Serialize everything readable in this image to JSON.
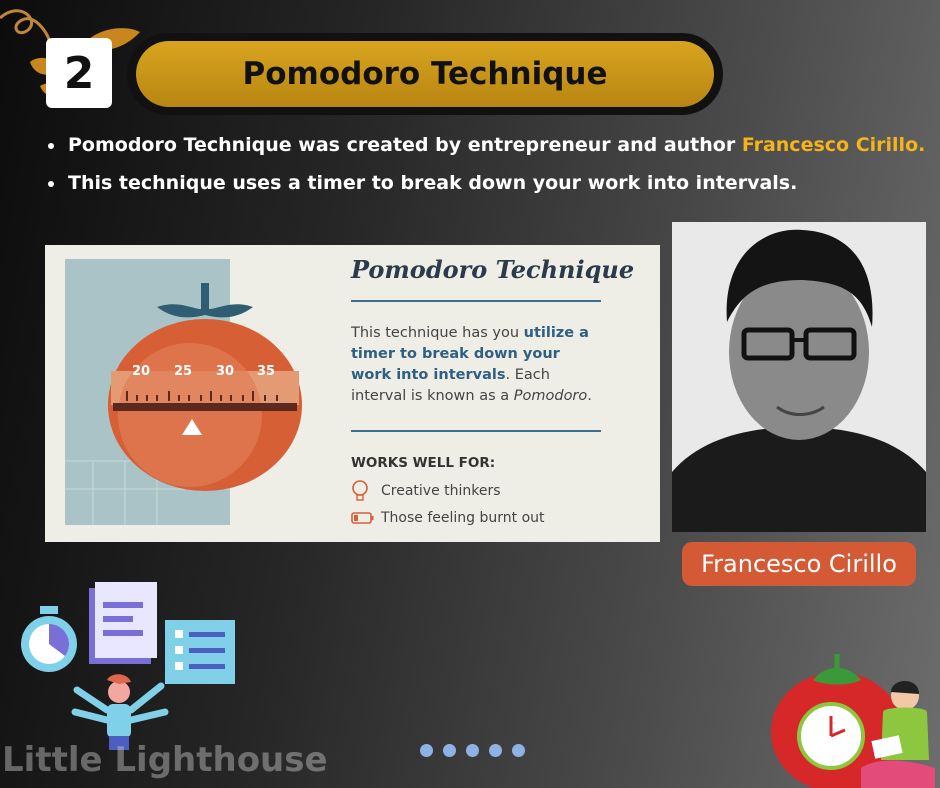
{
  "header": {
    "step_number": "2",
    "title": "Pomodoro Technique"
  },
  "bullets": {
    "line1_prefix": "Pomodoro Technique was created by entrepreneur and author ",
    "line1_highlight": "Francesco Cirillo.",
    "line2": "This technique uses a timer to break down your work into intervals."
  },
  "infographic": {
    "title": "Pomodoro Technique",
    "desc_prefix": "This technique has you ",
    "desc_bold": "utilize a timer to break down your work into intervals",
    "desc_mid": ". Each interval is known as a ",
    "desc_italic": "Pomodoro",
    "desc_end": ".",
    "works_label": "WORKS WELL FOR:",
    "items": [
      "Creative thinkers",
      "Those feeling burnt out"
    ],
    "dial_numbers": [
      "20",
      "25",
      "30",
      "35"
    ]
  },
  "person": {
    "name": "Francesco Cirillo"
  },
  "footer": {
    "watermark": "Little Lighthouse",
    "page_dots": 5
  },
  "colors": {
    "accent_gold": "#c9961a",
    "highlight": "#f4b41a",
    "tomato": "#d35a35",
    "dots": "#8fb2e4"
  }
}
